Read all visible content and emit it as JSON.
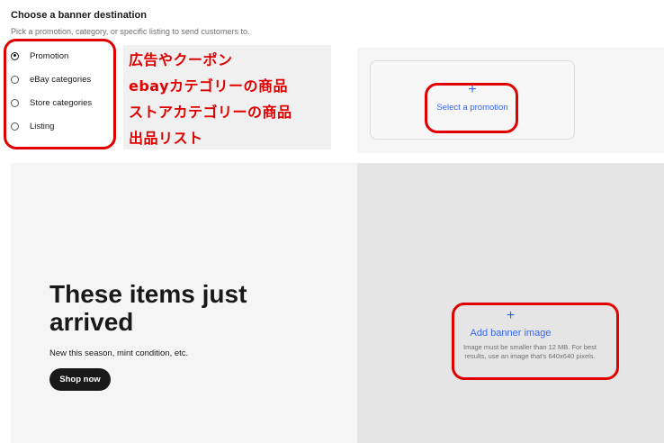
{
  "header": {
    "title": "Choose a banner destination",
    "subtitle": "Pick a promotion, category, or specific listing to send customers to."
  },
  "destinations": [
    {
      "label": "Promotion",
      "checked": true
    },
    {
      "label": "eBay categories",
      "checked": false
    },
    {
      "label": "Store categories",
      "checked": false
    },
    {
      "label": "Listing",
      "checked": false
    }
  ],
  "annotations": [
    "広告やクーポン",
    "ebayカテゴリーの商品",
    "ストアカテゴリーの商品",
    "出品リスト"
  ],
  "promotion_card": {
    "plus": "+",
    "label": "Select a promotion"
  },
  "banner": {
    "heading": "These items just arrived",
    "subheading": "New this season, mint condition, etc.",
    "button_label": "Shop now"
  },
  "image_upload": {
    "plus": "+",
    "label": "Add banner image",
    "note": "Image must be smaller than 12 MB. For best results, use an image that's 640x640 pixels."
  },
  "colors": {
    "link": "#3665f3",
    "annotation": "#e00000",
    "text": "#191919"
  }
}
